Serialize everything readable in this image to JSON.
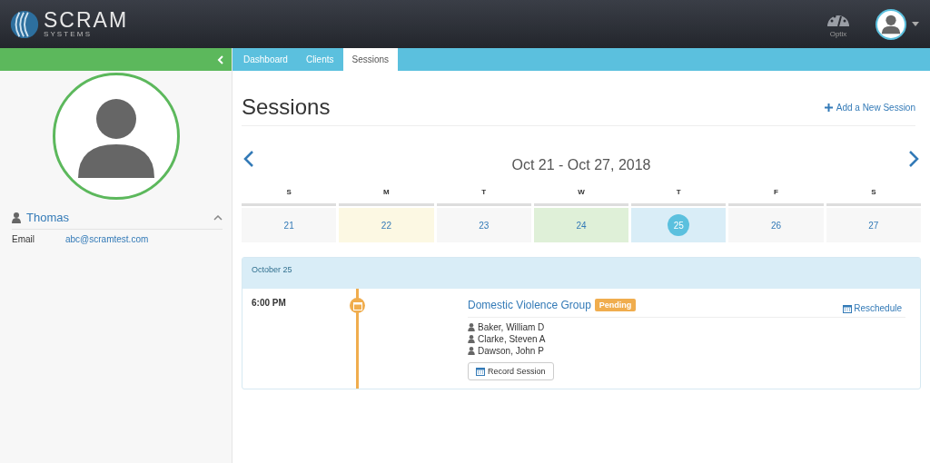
{
  "header": {
    "logo": {
      "name": "SCRAM",
      "sub": "S Y S T E M S"
    },
    "optix": "Optix"
  },
  "sidebar": {
    "name": "Thomas",
    "expanded": true,
    "fields": [
      {
        "label": "Email",
        "value": "abc@scramtest.com"
      }
    ]
  },
  "tabs": [
    {
      "label": "Dashboard",
      "selected": false
    },
    {
      "label": "Clients",
      "selected": false
    },
    {
      "label": "Sessions",
      "selected": true
    }
  ],
  "page": {
    "title": "Sessions",
    "add": "Add a New Session",
    "range": "Oct 21 - Oct 27, 2018"
  },
  "week": [
    {
      "dow": "S",
      "day": "21",
      "color": "#f7f7f7",
      "selected": false
    },
    {
      "dow": "M",
      "day": "22",
      "color": "#fcf8e3",
      "selected": false
    },
    {
      "dow": "T",
      "day": "23",
      "color": "#f7f7f7",
      "selected": false
    },
    {
      "dow": "W",
      "day": "24",
      "color": "#dff0d8",
      "selected": false
    },
    {
      "dow": "T",
      "day": "25",
      "color": "#d9edf7",
      "selected": true
    },
    {
      "dow": "F",
      "day": "26",
      "color": "#f7f7f7",
      "selected": false
    },
    {
      "dow": "S",
      "day": "27",
      "color": "#f7f7f7",
      "selected": false
    }
  ],
  "agenda": {
    "date": "October 25",
    "sessions": [
      {
        "time": "6:00 PM",
        "title": "Domestic Violence Group",
        "status": "Pending",
        "reschedule": "Reschedule",
        "clients": [
          "Baker, William D",
          "Clarke, Steven A",
          "Dawson, John P"
        ],
        "record": "Record Session"
      }
    ]
  }
}
